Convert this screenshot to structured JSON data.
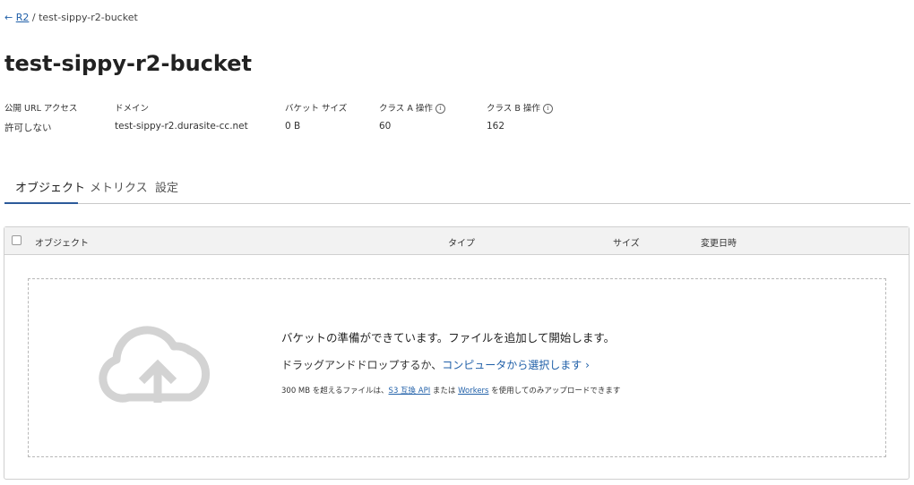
{
  "breadcrumb": {
    "back_arrow": "←",
    "parent": "R2",
    "separator": "/",
    "current": "test-sippy-r2-bucket"
  },
  "title": "test-sippy-r2-bucket",
  "meta": {
    "public_url": {
      "label": "公開 URL アクセス",
      "value": "許可しない"
    },
    "domain": {
      "label": "ドメイン",
      "value": "test-sippy-r2.durasite-cc.net"
    },
    "bucket_size": {
      "label": "バケット サイズ",
      "value": "0 B"
    },
    "class_a": {
      "label": "クラス A 操作",
      "value": "60"
    },
    "class_b": {
      "label": "クラス B 操作",
      "value": "162"
    },
    "info_glyph": "i"
  },
  "tabs": [
    {
      "label": "オブジェクト",
      "active": true
    },
    {
      "label": "メトリクス",
      "active": false
    },
    {
      "label": "設定",
      "active": false
    }
  ],
  "table": {
    "columns": [
      "オブジェクト",
      "タイプ",
      "サイズ",
      "変更日時"
    ]
  },
  "dropzone": {
    "title": "バケットの準備ができています。ファイルを追加して開始します。",
    "line_prefix": "ドラッグアンドドロップするか、",
    "line_link": "コンピュータから選択します",
    "line_chevron": "›",
    "note_prefix": "300 MB を超えるファイルは、",
    "note_link1": "S3 互換 API",
    "note_mid": " または ",
    "note_link2": "Workers",
    "note_suffix": " を使用してのみアップロードできます",
    "icon": "cloud-upload-icon"
  },
  "colors": {
    "link": "#1f5fa8",
    "tab_underline": "#2c5a9a",
    "header_bg": "#f2f2f2",
    "icon_gray": "#d3d3d3"
  }
}
